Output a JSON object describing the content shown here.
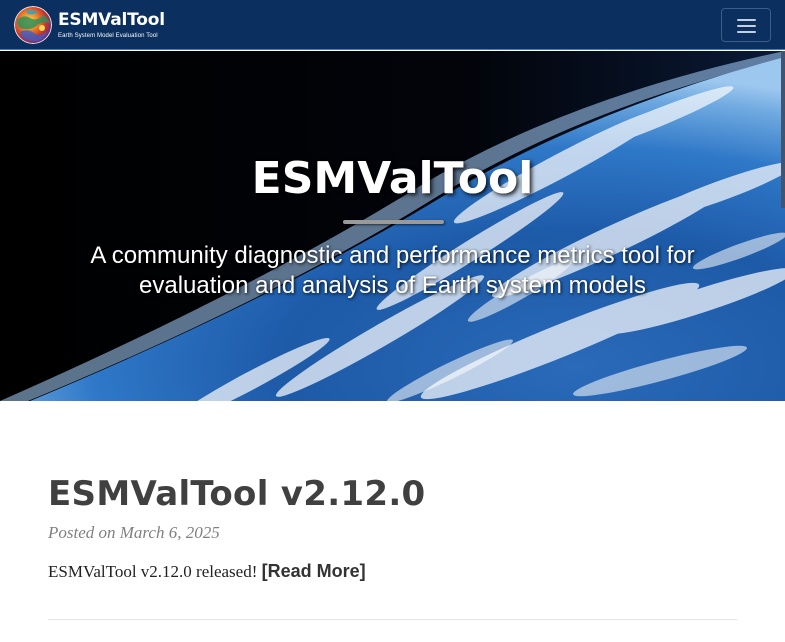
{
  "colors": {
    "navbar_bg": "#0b2f5e",
    "title_text": "#404040",
    "meta_text": "#808080",
    "body_text": "#222222"
  },
  "navbar": {
    "brand_title": "ESMValTool",
    "brand_subtitle": "Earth System Model Evaluation Tool",
    "logo_icon": "globe-logo-icon",
    "toggle_icon": "hamburger-menu-icon"
  },
  "hero": {
    "background": "earth-from-space-image",
    "title": "ESMValTool",
    "tagline_line1": "A community diagnostic and performance metrics tool for",
    "tagline_line2": "evaluation and analysis of Earth system models"
  },
  "post": {
    "title": "ESMValTool v2.12.0",
    "meta": "Posted on March 6, 2025",
    "body": "ESMValTool v2.12.0 released! ",
    "read_more": "[Read More]"
  }
}
